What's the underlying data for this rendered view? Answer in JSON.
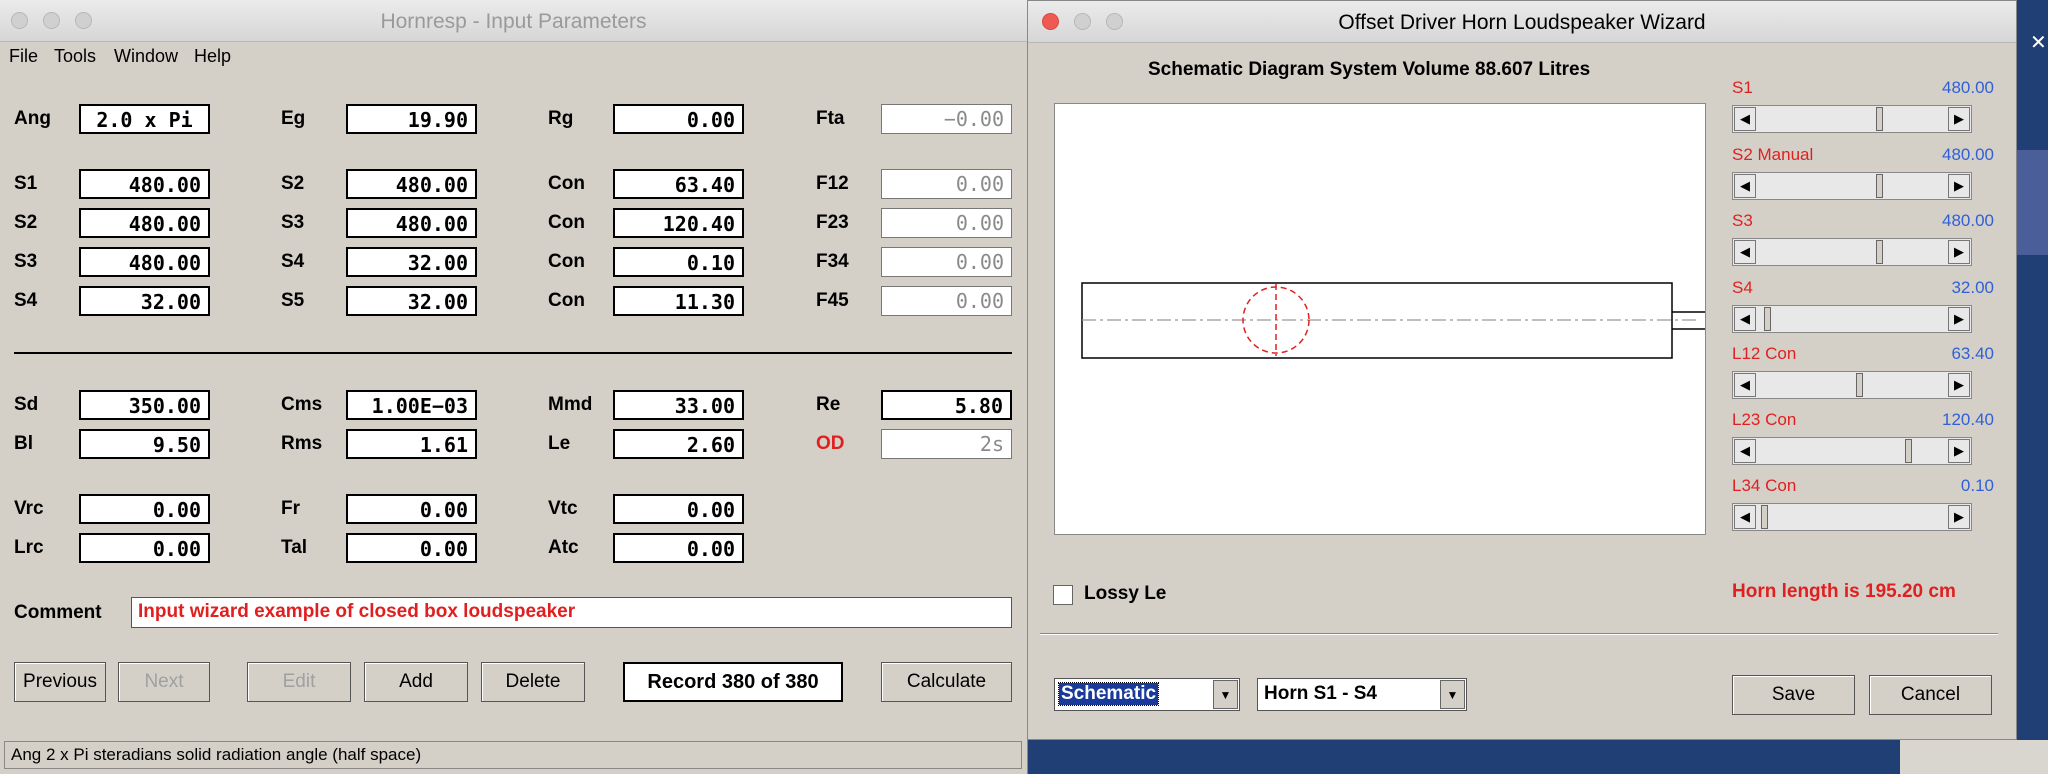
{
  "main": {
    "title": "Hornresp - Input Parameters",
    "menu": [
      "File",
      "Tools",
      "Window",
      "Help"
    ],
    "labels": {
      "ang": "Ang",
      "eg": "Eg",
      "rg": "Rg",
      "fta": "Fta",
      "s1a": "S1",
      "s2b": "S2",
      "con1": "Con",
      "f12": "F12",
      "s2a": "S2",
      "s3b": "S3",
      "con2": "Con",
      "f23": "F23",
      "s3a": "S3",
      "s4b": "S4",
      "con3": "Con",
      "f34": "F34",
      "s4a": "S4",
      "s5b": "S5",
      "con4": "Con",
      "f45": "F45",
      "sd": "Sd",
      "cms": "Cms",
      "mmd": "Mmd",
      "re": "Re",
      "bl": "Bl",
      "rms": "Rms",
      "le": "Le",
      "od": "OD",
      "vrc": "Vrc",
      "fr": "Fr",
      "vtc": "Vtc",
      "lrc": "Lrc",
      "tal": "Tal",
      "atc": "Atc",
      "comment": "Comment"
    },
    "values": {
      "ang": "2.0 x Pi",
      "eg": "19.90",
      "rg": "0.00",
      "fta": "−0.00",
      "s1": "480.00",
      "s2": "480.00",
      "con1": "63.40",
      "f12": "0.00",
      "s2a": "480.00",
      "s3": "480.00",
      "con2": "120.40",
      "f23": "0.00",
      "s3a": "480.00",
      "s4": "32.00",
      "con3": "0.10",
      "f34": "0.00",
      "s4a": "32.00",
      "s5": "32.00",
      "con4": "11.30",
      "f45": "0.00",
      "sd": "350.00",
      "cms": "1.00E−03",
      "mmd": "33.00",
      "re": "5.80",
      "bl": "9.50",
      "rms": "1.61",
      "le": "2.60",
      "od": "2s",
      "vrc": "0.00",
      "fr": "0.00",
      "vtc": "0.00",
      "lrc": "0.00",
      "tal": "0.00",
      "atc": "0.00"
    },
    "comment": "Input wizard example of closed box loudspeaker",
    "buttons": {
      "previous": "Previous",
      "next": "Next",
      "edit": "Edit",
      "add": "Add",
      "delete": "Delete",
      "calculate": "Calculate"
    },
    "record": "Record 380 of 380",
    "status": "Ang   2 x Pi steradians solid radiation angle  (half space)"
  },
  "wizard": {
    "title": "Offset Driver Horn Loudspeaker Wizard",
    "schematic_title": "Schematic Diagram   System Volume 88.607 Litres",
    "sliders": [
      {
        "label": "S1",
        "value": "480.00",
        "position": 0.65
      },
      {
        "label": "S2  Manual",
        "value": "480.00",
        "position": 0.65
      },
      {
        "label": "S3",
        "value": "480.00",
        "position": 0.65
      },
      {
        "label": "S4",
        "value": "32.00",
        "position": 0.04
      },
      {
        "label": "L12  Con",
        "value": "63.40",
        "position": 0.54
      },
      {
        "label": "L23  Con",
        "value": "120.40",
        "position": 0.81
      },
      {
        "label": "L34  Con",
        "value": "0.10",
        "position": 0.02
      }
    ],
    "lossy_le": "Lossy Le",
    "horn_length": "Horn length is 195.20 cm",
    "combo1": "Schematic",
    "combo2": "Horn S1 - S4",
    "save": "Save",
    "cancel": "Cancel"
  }
}
